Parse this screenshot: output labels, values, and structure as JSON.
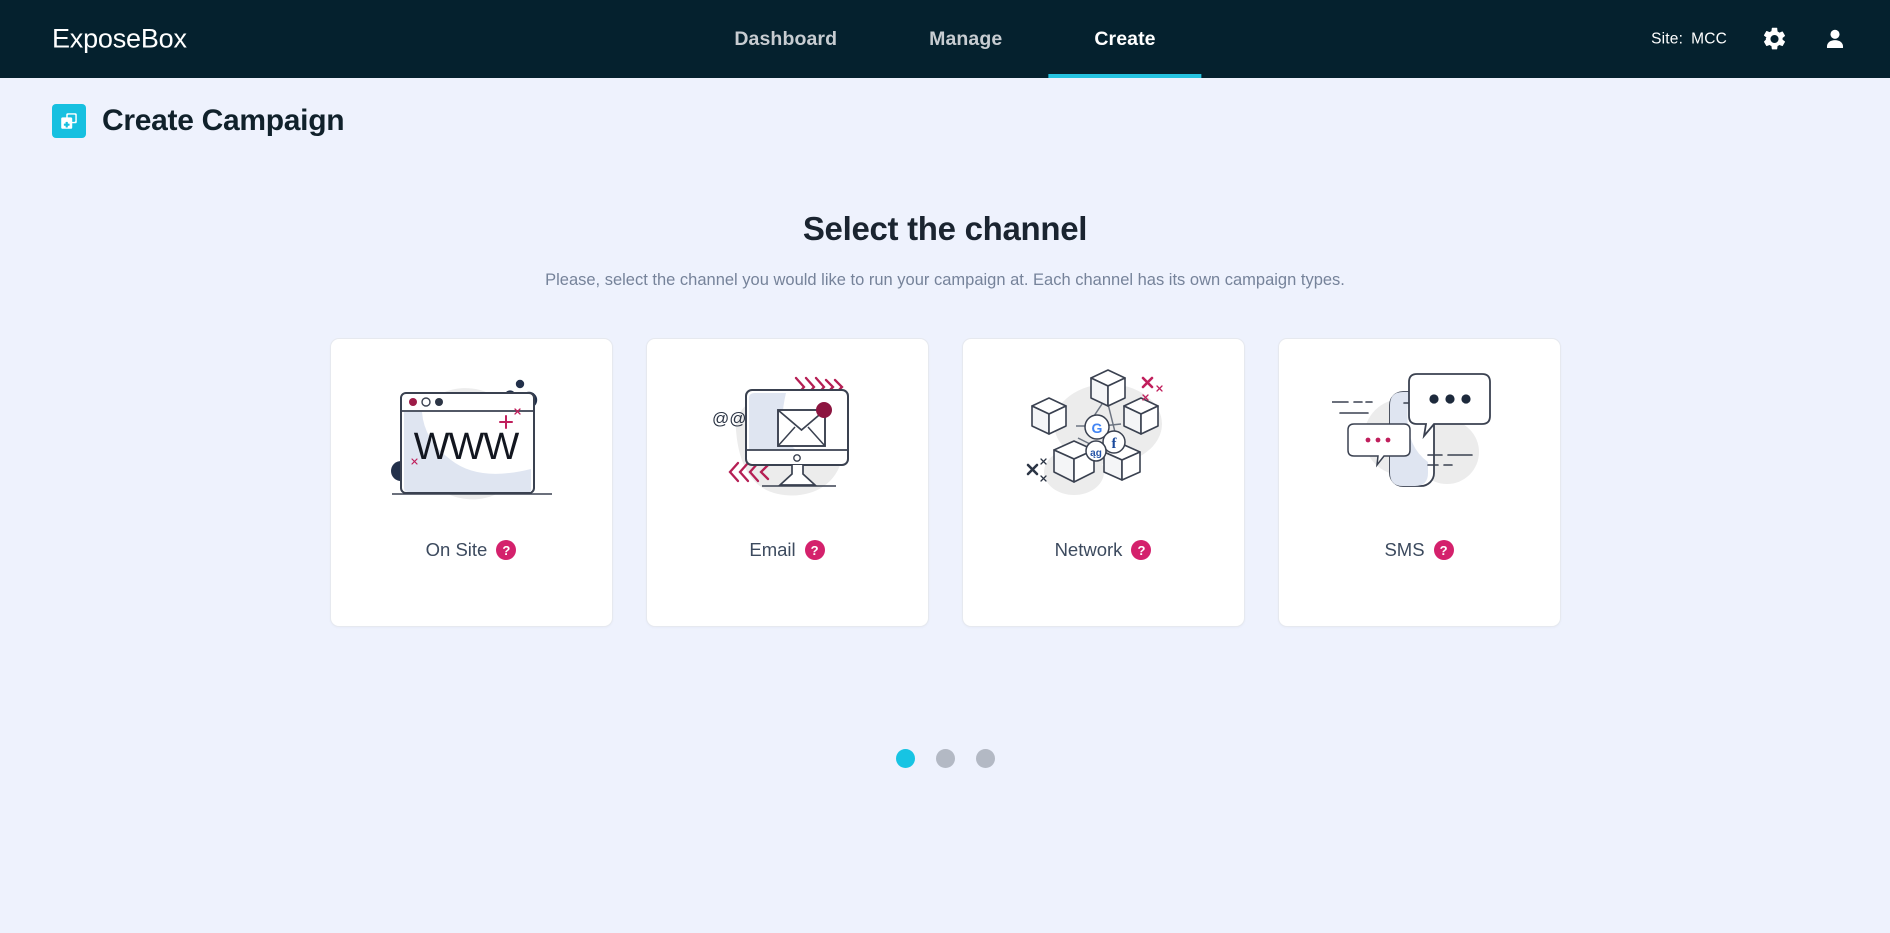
{
  "header": {
    "brand": "ExposeBox",
    "tabs": [
      {
        "label": "Dashboard",
        "active": false
      },
      {
        "label": "Manage",
        "active": false
      },
      {
        "label": "Create",
        "active": true
      }
    ],
    "site_key": "Site:",
    "site_value": "MCC",
    "settings_icon": "gear-icon",
    "account_icon": "user-icon",
    "background_color": "#05212e",
    "active_tab_accent": "#25c3e0"
  },
  "page": {
    "icon": "create-campaign-icon",
    "title": "Create Campaign",
    "icon_color": "#16c0e0",
    "background_color": "#eef2fd"
  },
  "main": {
    "section_title": "Select the channel",
    "section_subtitle": "Please, select the channel you would like to run your campaign at. Each channel has its own campaign types.",
    "channels": [
      {
        "label": "On Site",
        "art": "browser-window-www-illustration",
        "help": "?"
      },
      {
        "label": "Email",
        "art": "desktop-monitor-envelope-illustration",
        "help": "?"
      },
      {
        "label": "Network",
        "art": "cubes-social-network-illustration",
        "help": "?"
      },
      {
        "label": "SMS",
        "art": "phone-chat-bubbles-illustration",
        "help": "?"
      }
    ],
    "help_badge_color": "#d4216c"
  },
  "pagination": {
    "dots": [
      {
        "active": true
      },
      {
        "active": false
      },
      {
        "active": false
      }
    ],
    "active_color": "#17c4e3",
    "inactive_color": "#b3b9c4"
  }
}
